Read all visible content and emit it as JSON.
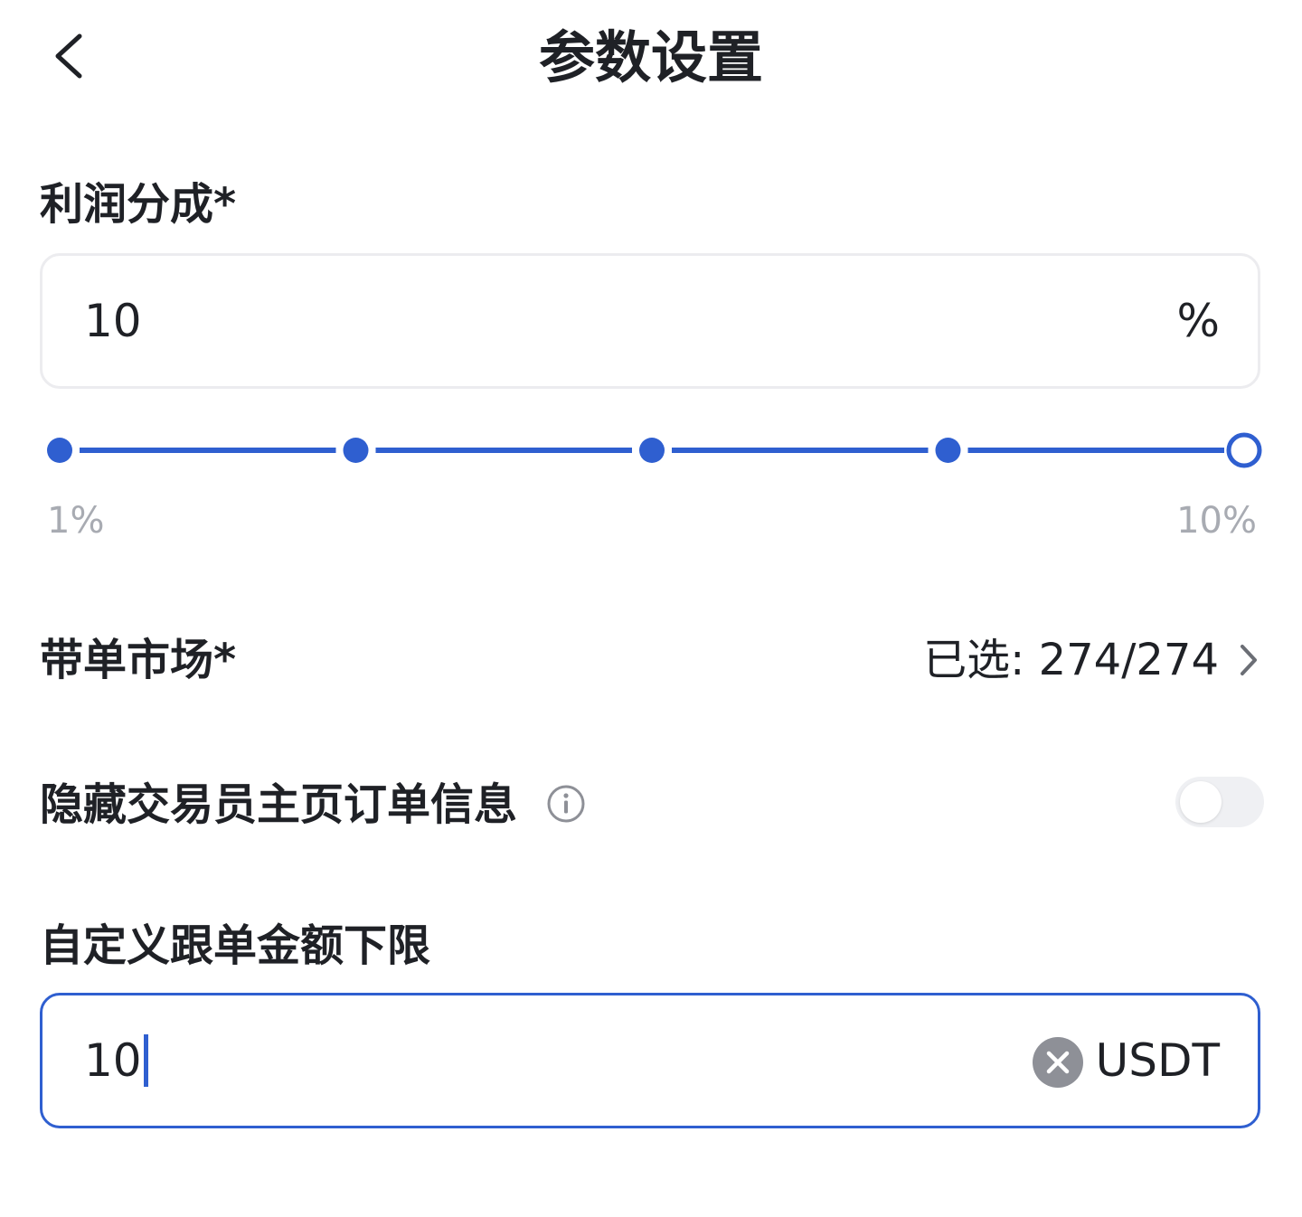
{
  "header": {
    "title": "参数设置",
    "back_icon": "chevron-left-icon"
  },
  "profit_share": {
    "label": "利润分成*",
    "value": "10",
    "unit": "%",
    "slider": {
      "min_label": "1%",
      "max_label": "10%",
      "stops": 5,
      "selected_stop_index": 4,
      "accent_color": "#2f5fd0"
    }
  },
  "market": {
    "label": "带单市场*",
    "value": "已选: 274/274",
    "chevron_icon": "chevron-right-icon"
  },
  "hide_orders": {
    "label": "隐藏交易员主页订单信息",
    "info_icon": "info-icon",
    "toggle_on": false
  },
  "min_follow_amount": {
    "label": "自定义跟单金额下限",
    "value": "10",
    "unit": "USDT",
    "clear_icon": "clear-icon"
  }
}
